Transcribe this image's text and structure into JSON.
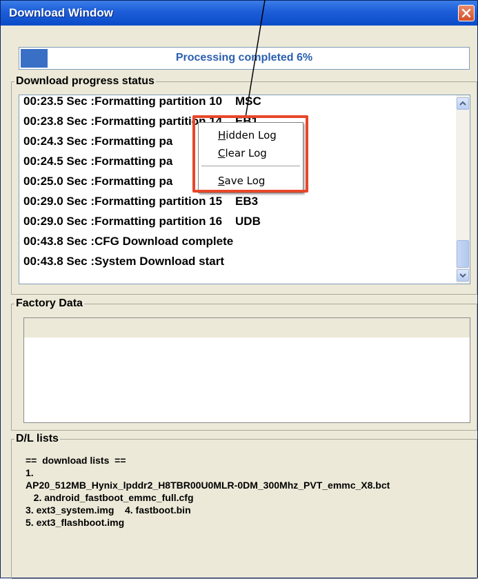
{
  "window": {
    "title": "Download Window"
  },
  "progress": {
    "text": "Processing completed 6%",
    "percent": 6
  },
  "log_group": {
    "label": "Download progress status",
    "lines": [
      "00:23.5 Sec :Formatting partition 10    MSC",
      "00:23.8 Sec :Formatting partition 14    EB1",
      "00:24.3 Sec :Formatting pa",
      "00:24.5 Sec :Formatting pa",
      "00:25.0 Sec :Formatting pa",
      "00:29.0 Sec :Formatting partition 15    EB3",
      "00:29.0 Sec :Formatting partition 16    UDB",
      "00:43.8 Sec :CFG Download complete",
      "00:43.8 Sec :System Download start"
    ]
  },
  "context_menu": {
    "items": [
      "Hidden Log",
      "Clear Log",
      "Save Log"
    ]
  },
  "factory_group": {
    "label": "Factory Data"
  },
  "dl_group": {
    "label": "D/L lists",
    "lines": [
      "==  download lists  ==",
      "1.",
      "AP20_512MB_Hynix_lpddr2_H8TBR00U0MLR-0DM_300Mhz_PVT_emmc_X8.bct",
      "   2. android_fastboot_emmc_full.cfg",
      "3. ext3_system.img    4. fastboot.bin",
      "5. ext3_flashboot.img"
    ]
  },
  "colors": {
    "accent": "#2a5fb0",
    "highlight": "#e8462a",
    "progress_fill": "#3a6fc6"
  }
}
